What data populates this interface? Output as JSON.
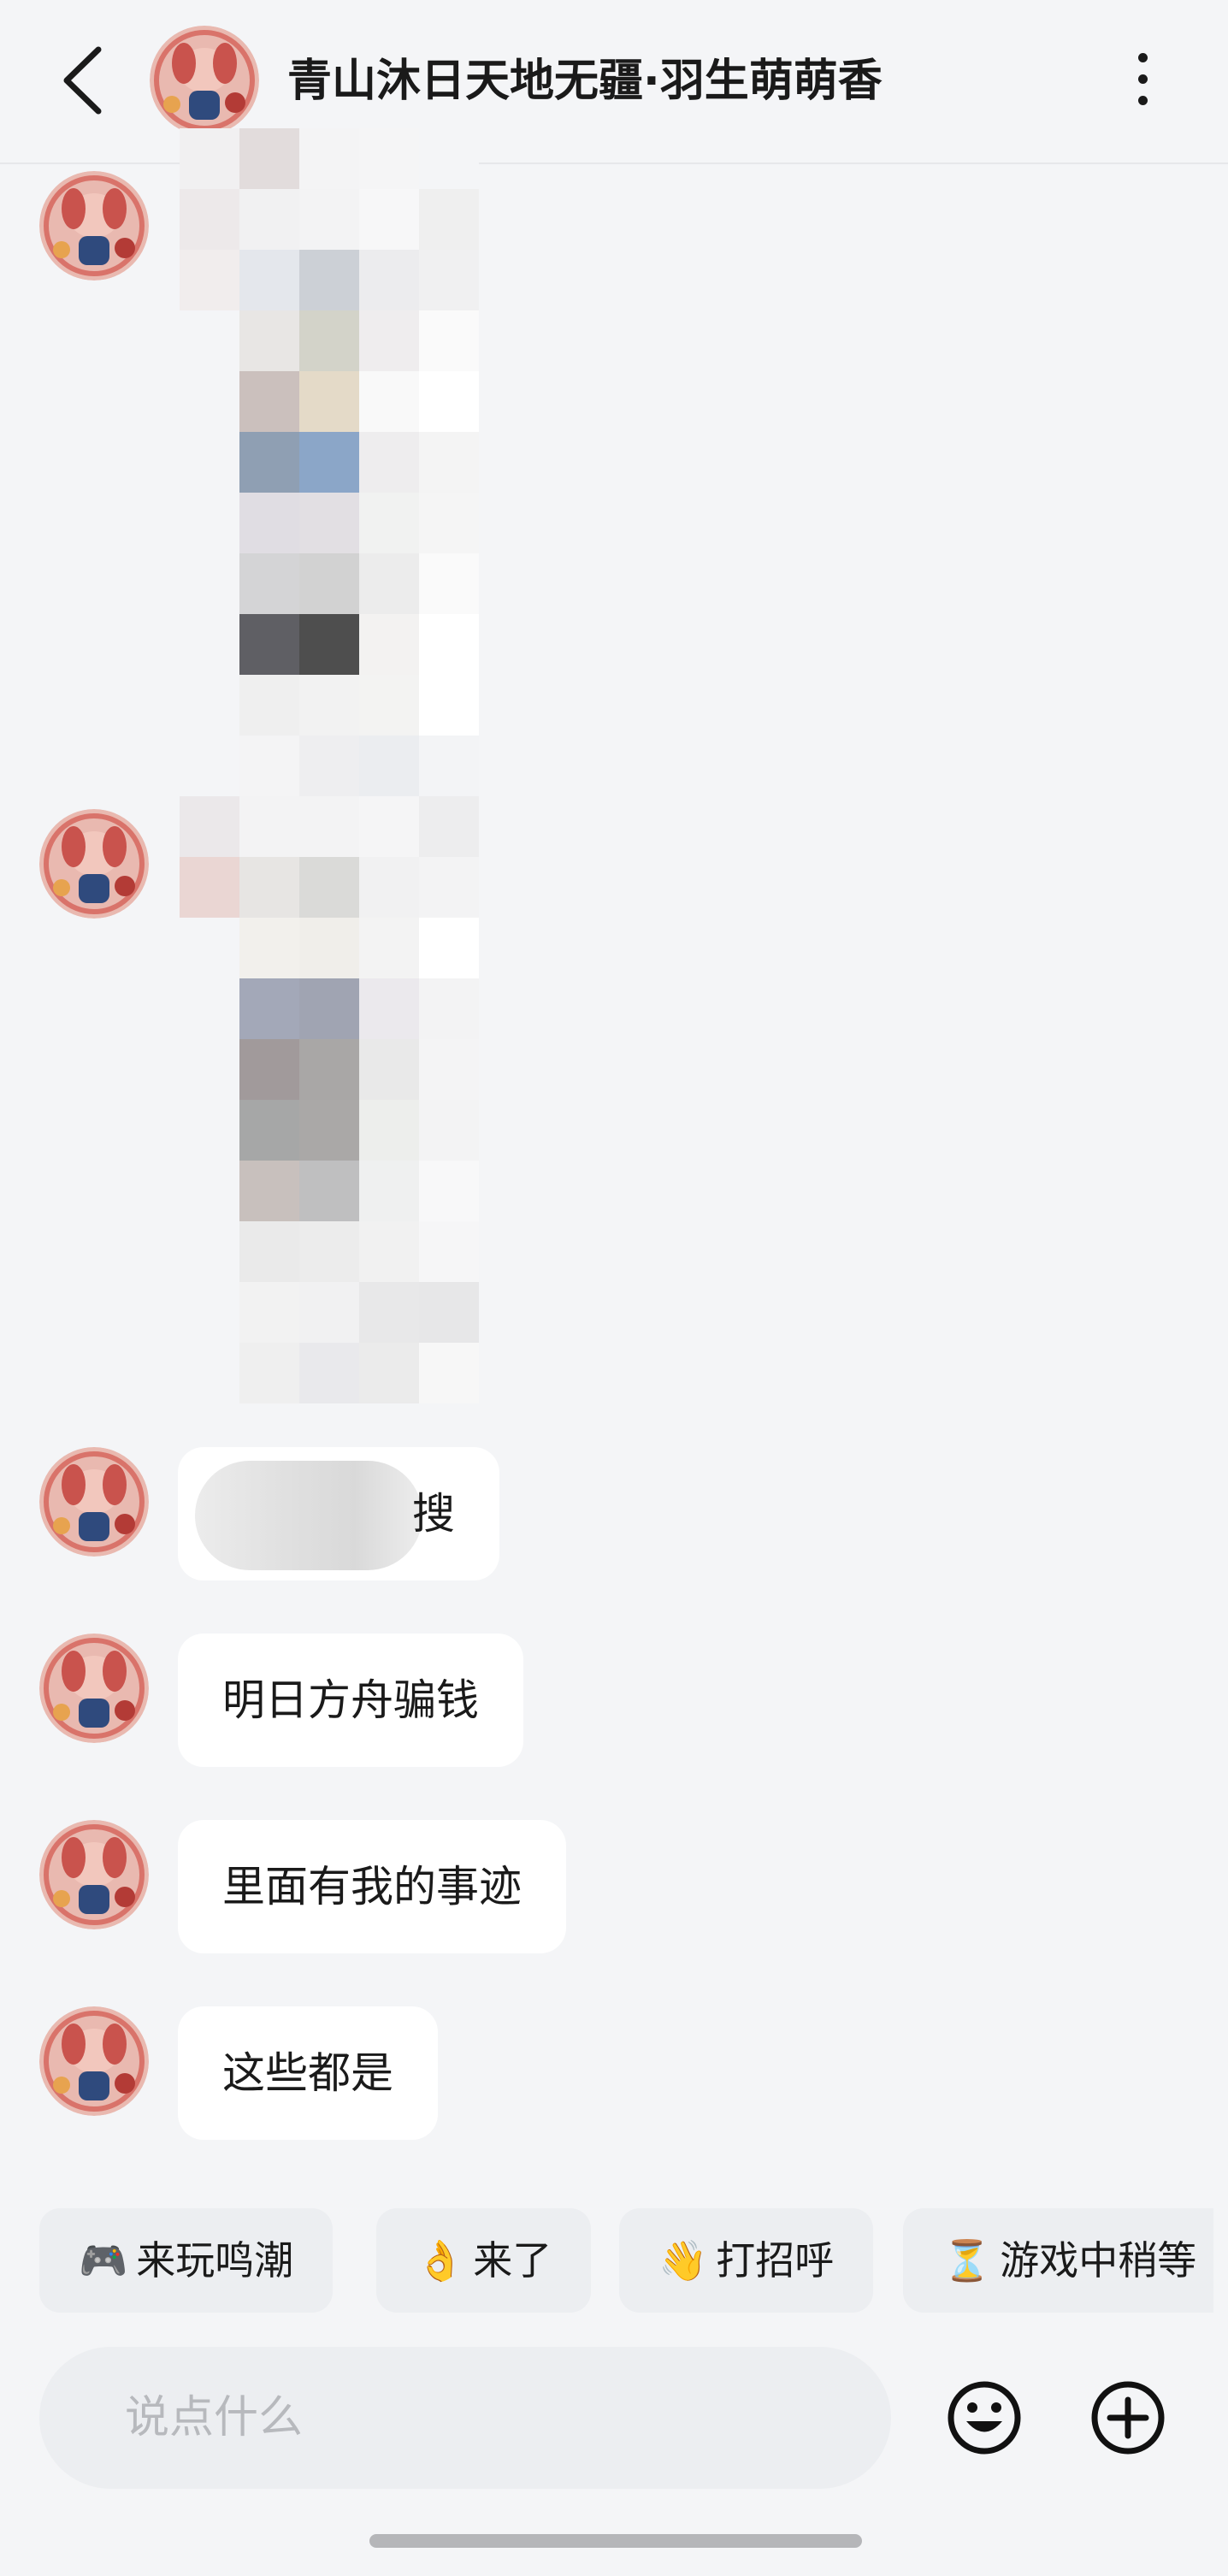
{
  "header": {
    "title": "青山沐日天地无疆·羽生萌萌香",
    "back_icon": "chevron-left-icon",
    "more_icon": "more-vertical-icon"
  },
  "messages": [
    {
      "type": "image",
      "content": "blurred-image"
    },
    {
      "type": "image",
      "content": "blurred-image"
    },
    {
      "type": "text",
      "text": "搜"
    },
    {
      "type": "text",
      "text": "明日方舟骗钱"
    },
    {
      "type": "text",
      "text": "里面有我的事迹"
    },
    {
      "type": "text",
      "text": "这些都是"
    }
  ],
  "quick_replies": [
    {
      "emoji": "🎮",
      "label": "来玩鸣潮"
    },
    {
      "emoji": "👌",
      "label": "来了"
    },
    {
      "emoji": "👋",
      "label": "打招呼"
    },
    {
      "emoji": "⏳",
      "label": "游戏中稍等"
    }
  ],
  "input": {
    "placeholder": "说点什么",
    "emoji_icon": "smiley-icon",
    "plus_icon": "plus-circle-icon"
  },
  "colors": {
    "background": "#f4f5f7",
    "bubble": "#ffffff",
    "chip": "#eceef1",
    "placeholder": "#b7b9bd"
  }
}
